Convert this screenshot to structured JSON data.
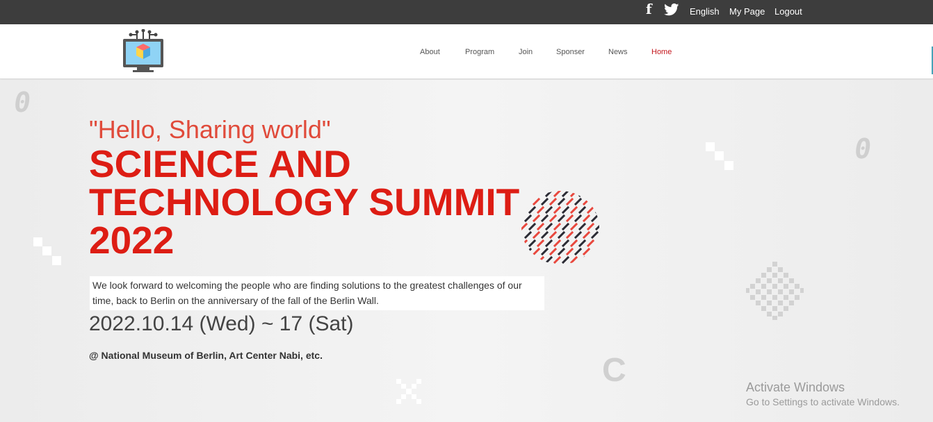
{
  "topbar": {
    "facebook_icon": "f",
    "links": [
      "English",
      "My Page",
      "Logout"
    ]
  },
  "nav": {
    "items": [
      "About",
      "Program",
      "Join",
      "Sponser",
      "News",
      "Home"
    ],
    "active": "Home"
  },
  "hero": {
    "greeting": "\"Hello, Sharing world\"",
    "title": "SCIENCE AND TECHNOLOGY SUMMIT 2022",
    "description": "We look forward to welcoming the people who are finding solutions to the greatest challenges of our time, back to Berlin on the anniversary of the fall of the Berlin Wall.",
    "date": "2022.10.14 (Wed) ~ 17 (Sat)",
    "venue": "@ National Museum of Berlin, Art Center Nabi, etc."
  },
  "decorations": {
    "zero_glyph": "0",
    "c_glyph": "C"
  },
  "watermark": {
    "title": "Activate Windows",
    "subtitle": "Go to Settings to activate Windows."
  },
  "colors": {
    "accent_red": "#dd1d14",
    "topbar_bg": "#3d3d3d",
    "active_nav": "#c4161c"
  }
}
